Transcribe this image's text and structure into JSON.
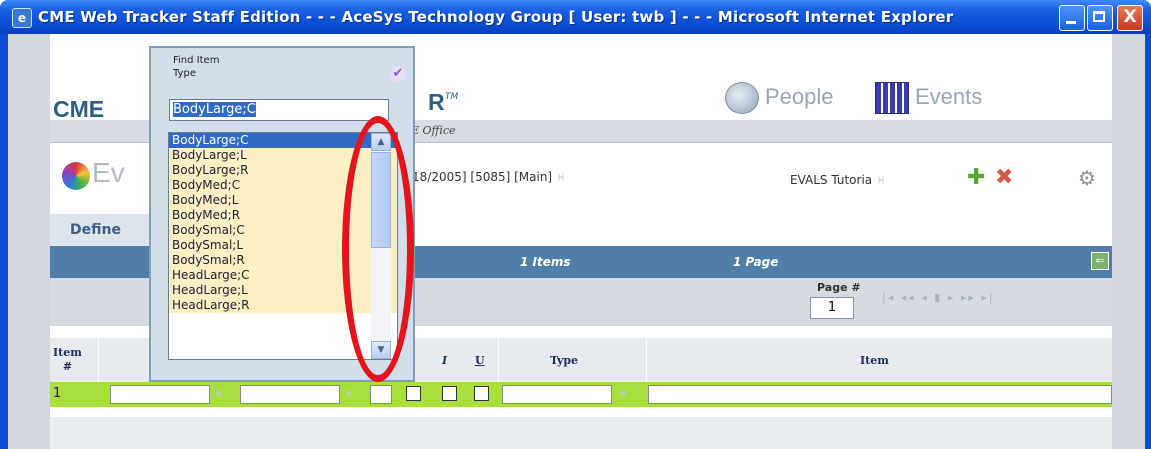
{
  "window": {
    "title": "CME Web Tracker Staff Edition - - - AceSys Technology Group [ User: twb ] - - - Microsoft Internet Explorer",
    "close_glyph": "X"
  },
  "header": {
    "logo_left": "CME",
    "logo_right": "R",
    "tm": "TM",
    "nav_people": "People",
    "nav_events": "Events",
    "office": "E Office"
  },
  "record": {
    "globe_text": "Ev",
    "info": "/18/2005] [5085] [Main]",
    "evals": "EVALS Tutoria"
  },
  "tab": {
    "define": "Define"
  },
  "summary": {
    "items": "1 Items",
    "pages": "1 Page"
  },
  "pagination": {
    "label": "Page #",
    "current": "1",
    "controls": "|◂ ◂◂ ◂ ▮ ▸ ▸▸ ▸|"
  },
  "table": {
    "col_item_num": "Item\n#",
    "col_i": "I",
    "col_u": "U",
    "col_type": "Type",
    "col_item": "Item",
    "row_num": "1"
  },
  "popup": {
    "title_line1": "Find Item",
    "title_line2": "Type",
    "search_value": "BodyLarge;C",
    "options": [
      "BodyLarge;C",
      "BodyLarge;L",
      "BodyLarge;R",
      "BodyMed;C",
      "BodyMed;L",
      "BodyMed;R",
      "BodySmal;C",
      "BodySmal;L",
      "BodySmal;R",
      "HeadLarge;C",
      "HeadLarge;L",
      "HeadLarge;R"
    ],
    "selected_index": 0
  },
  "colors": {
    "titlebar": "#0a4fd4",
    "header_blue": "#4f7fa8",
    "row_green": "#a8df3c",
    "highlight_oval": "#e3141b"
  }
}
